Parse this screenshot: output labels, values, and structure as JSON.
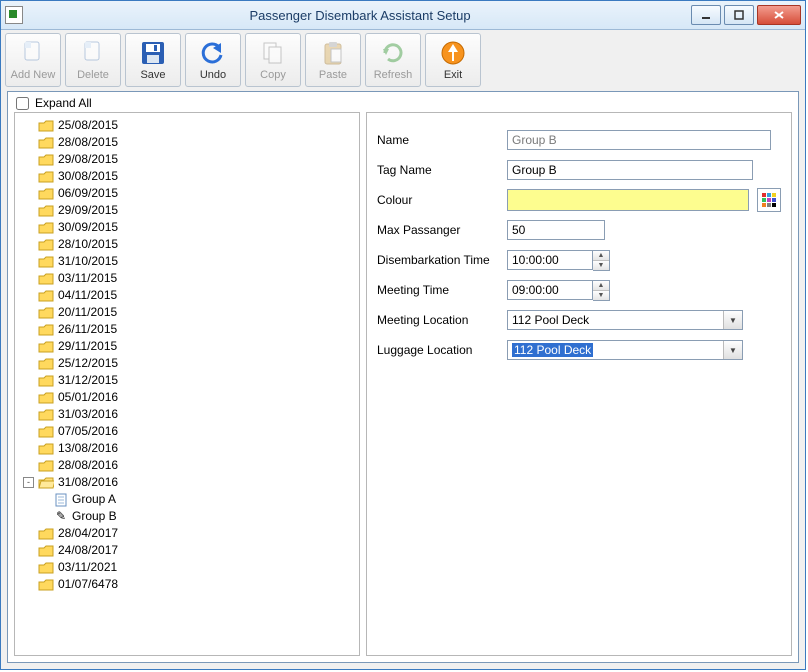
{
  "window": {
    "title": "Passenger Disembark Assistant Setup"
  },
  "toolbar": [
    {
      "id": "add-new",
      "label": "Add New",
      "enabled": false,
      "icon": "page-plus"
    },
    {
      "id": "delete",
      "label": "Delete",
      "enabled": false,
      "icon": "page-minus"
    },
    {
      "id": "save",
      "label": "Save",
      "enabled": true,
      "icon": "floppy"
    },
    {
      "id": "undo",
      "label": "Undo",
      "enabled": true,
      "icon": "undo"
    },
    {
      "id": "copy",
      "label": "Copy",
      "enabled": false,
      "icon": "copy"
    },
    {
      "id": "paste",
      "label": "Paste",
      "enabled": false,
      "icon": "paste"
    },
    {
      "id": "refresh",
      "label": "Refresh",
      "enabled": false,
      "icon": "refresh"
    },
    {
      "id": "exit",
      "label": "Exit",
      "enabled": true,
      "icon": "exit"
    }
  ],
  "expand_all": {
    "label": "Expand All",
    "checked": false
  },
  "tree": [
    {
      "label": "25/08/2015",
      "type": "folder"
    },
    {
      "label": "28/08/2015",
      "type": "folder"
    },
    {
      "label": "29/08/2015",
      "type": "folder"
    },
    {
      "label": "30/08/2015",
      "type": "folder"
    },
    {
      "label": "06/09/2015",
      "type": "folder"
    },
    {
      "label": "29/09/2015",
      "type": "folder"
    },
    {
      "label": "30/09/2015",
      "type": "folder"
    },
    {
      "label": "28/10/2015",
      "type": "folder"
    },
    {
      "label": "31/10/2015",
      "type": "folder"
    },
    {
      "label": "03/11/2015",
      "type": "folder"
    },
    {
      "label": "04/11/2015",
      "type": "folder"
    },
    {
      "label": "20/11/2015",
      "type": "folder"
    },
    {
      "label": "26/11/2015",
      "type": "folder"
    },
    {
      "label": "29/11/2015",
      "type": "folder"
    },
    {
      "label": "25/12/2015",
      "type": "folder"
    },
    {
      "label": "31/12/2015",
      "type": "folder"
    },
    {
      "label": "05/01/2016",
      "type": "folder"
    },
    {
      "label": "31/03/2016",
      "type": "folder"
    },
    {
      "label": "07/05/2016",
      "type": "folder"
    },
    {
      "label": "13/08/2016",
      "type": "folder"
    },
    {
      "label": "28/08/2016",
      "type": "folder"
    },
    {
      "label": "31/08/2016",
      "type": "folder-open",
      "expanded": true,
      "children": [
        {
          "label": "Group A",
          "type": "leaf",
          "icon": "page"
        },
        {
          "label": "Group B",
          "type": "leaf",
          "icon": "edit",
          "selected": true
        }
      ]
    },
    {
      "label": "28/04/2017",
      "type": "folder"
    },
    {
      "label": "24/08/2017",
      "type": "folder"
    },
    {
      "label": "03/11/2021",
      "type": "folder"
    },
    {
      "label": "01/07/6478",
      "type": "folder"
    }
  ],
  "form": {
    "name": {
      "label": "Name",
      "value": "Group B",
      "readonly": true
    },
    "tag_name": {
      "label": "Tag Name",
      "value": "Group B"
    },
    "colour": {
      "label": "Colour",
      "value": "#fdfd8f"
    },
    "max_passenger": {
      "label": "Max Passanger",
      "value": "50"
    },
    "disembark_time": {
      "label": "Disembarkation Time",
      "value": "10:00:00"
    },
    "meeting_time": {
      "label": "Meeting Time",
      "value": "09:00:00"
    },
    "meeting_location": {
      "label": "Meeting Location",
      "value": "112 Pool Deck"
    },
    "luggage_location": {
      "label": "Luggage Location",
      "value": "112 Pool Deck",
      "highlighted": true
    }
  }
}
